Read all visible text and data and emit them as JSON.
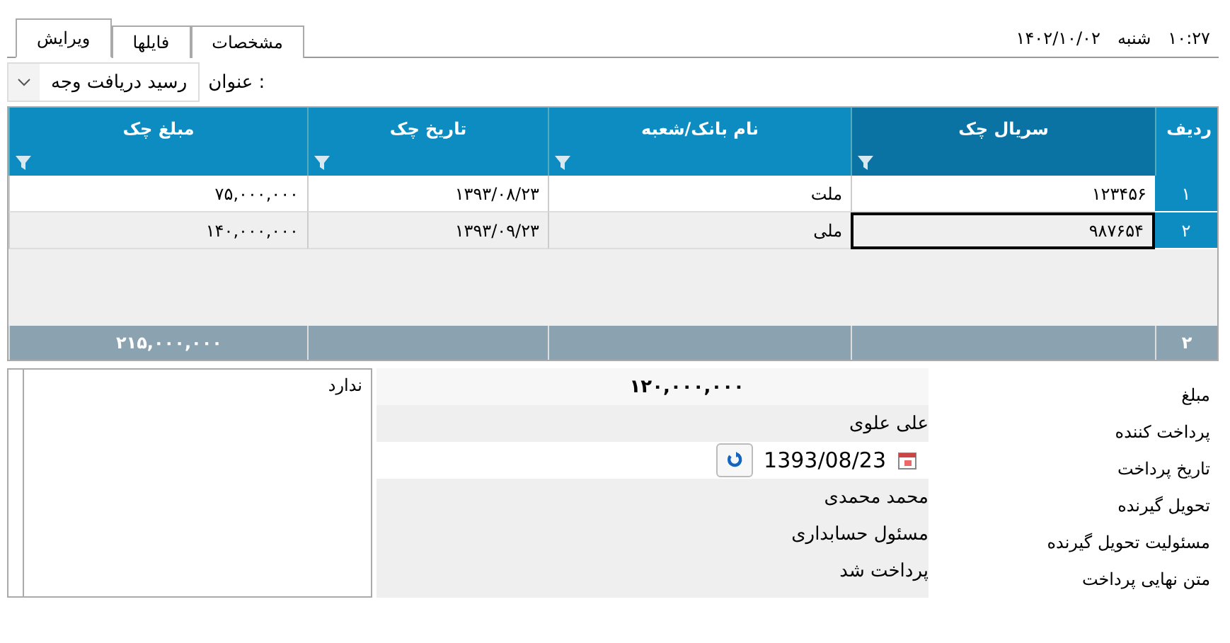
{
  "tabs": [
    {
      "label": "مشخصات",
      "selected": false
    },
    {
      "label": "فایلها",
      "selected": false
    },
    {
      "label": "ویرایش",
      "selected": true
    }
  ],
  "clock": {
    "date": "۱۴۰۲/۱۰/۰۲",
    "weekday": "شنبه",
    "time": "۱۰:۲۷"
  },
  "title_field": {
    "label": "عنوان :",
    "value": "رسید دریافت وجه"
  },
  "table": {
    "row_header": "ردیف",
    "columns": [
      {
        "label": "سریال چک",
        "selected": true
      },
      {
        "label": "نام بانک/شعبه",
        "selected": false
      },
      {
        "label": "تاریخ چک",
        "selected": false
      },
      {
        "label": "مبلغ چک",
        "selected": false
      }
    ],
    "rows": [
      {
        "index": "۱",
        "cells": [
          "۱۲۳۴۵۶",
          "ملت",
          "۱۳۹۳/۰۸/۲۳",
          "۷۵,۰۰۰,۰۰۰"
        ],
        "selected": false
      },
      {
        "index": "۲",
        "cells": [
          "۹۸۷۶۵۴",
          "ملی",
          "۱۳۹۳/۰۹/۲۳",
          "۱۴۰,۰۰۰,۰۰۰"
        ],
        "selected": true
      }
    ],
    "footer": {
      "count": "۲",
      "cells": [
        "",
        "",
        "",
        "۲۱۵,۰۰۰,۰۰۰"
      ]
    }
  },
  "details": {
    "note": "ندارد",
    "fields": [
      {
        "label": "مبلغ",
        "value": "۱۲۰,۰۰۰,۰۰۰",
        "kind": "bold"
      },
      {
        "label": "پرداخت کننده",
        "value": "علی علوی",
        "kind": "text"
      },
      {
        "label": "تاریخ پرداخت",
        "value": "1393/08/23",
        "kind": "date"
      },
      {
        "label": "تحویل گیرنده",
        "value": "محمد محمدی",
        "kind": "text"
      },
      {
        "label": "مسئولیت تحویل گیرنده",
        "value": "مسئول حسابداری",
        "kind": "text"
      },
      {
        "label": "متن نهایی پرداخت",
        "value": "پرداخت شد",
        "kind": "text"
      }
    ]
  }
}
